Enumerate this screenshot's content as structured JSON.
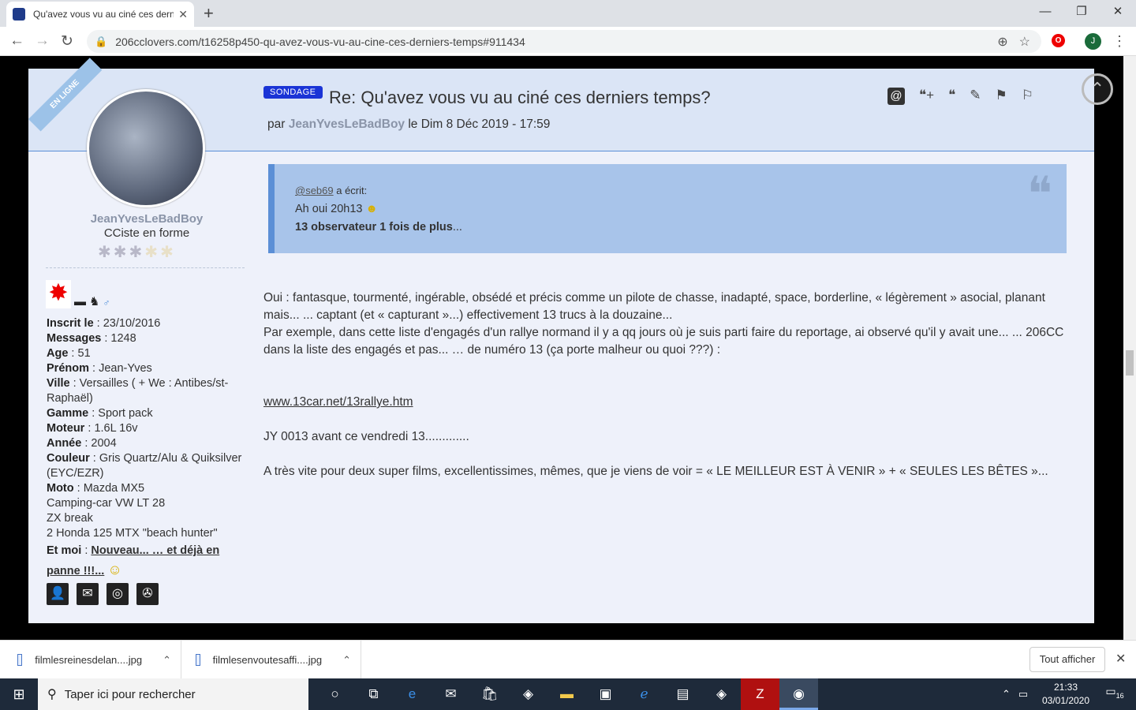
{
  "browser": {
    "tab_title": "Qu'avez vous vu au ciné ces derniers temps?",
    "url": "206cclovers.com/t16258p450-qu-avez-vous-vu-au-cine-ces-derniers-temps#911434",
    "profile_initial": "J"
  },
  "post": {
    "online_ribbon": "EN LIGNE",
    "badge": "SONDAGE",
    "title": "Re: Qu'avez vous vu au ciné ces derniers temps?",
    "by_prefix": "par",
    "author": "JeanYvesLeBadBoy",
    "date": "le Dim 8 Déc 2019 - 17:59",
    "quote": {
      "user": "@seb69",
      "wrote": " a écrit:",
      "line1": "Ah oui 20h13",
      "line2_bold": "13 observateur 1 fois de plus",
      "line2_rest": "..."
    },
    "body": {
      "p1": "Oui : fantasque, tourmenté, ingérable, obsédé et précis comme un pilote de chasse, inadapté, space, borderline, « légèrement » asocial, planant mais... ... captant  (et « capturant »...) effectivement 13 trucs à la douzaine...",
      "p2": "Par exemple, dans cette liste d'engagés d'un rallye  normand il y a qq jours où je suis parti faire du reportage, ai observé qu'il y avait une... ... 206CC dans la liste des engagés et pas... … de numéro 13 (ça porte malheur ou quoi ???) :",
      "link": "www.13car.net/13rallye.htm",
      "p3": "JY 0013 avant ce vendredi 13.............",
      "p4": "A très vite pour deux super films, excellentissimes, mêmes, que je viens de voir = «  LE MEILLEUR EST À VENIR » + « SEULES LES BÊTES »..."
    }
  },
  "user": {
    "name": "JeanYvesLeBadBoy",
    "rank": "CCiste en forme",
    "fields": [
      {
        "label": "Inscrit le",
        "value": "23/10/2016"
      },
      {
        "label": "Messages",
        "value": "1248"
      },
      {
        "label": "Age",
        "value": "51"
      },
      {
        "label": "Prénom",
        "value": "Jean-Yves"
      },
      {
        "label": "Ville",
        "value": "Versailles ( + We : Antibes/st-Raphaël)"
      },
      {
        "label": "Gamme",
        "value": "Sport pack"
      },
      {
        "label": "Moteur",
        "value": "1.6L 16v"
      },
      {
        "label": "Année",
        "value": "2004"
      },
      {
        "label": "Couleur",
        "value": "Gris Quartz/Alu & Quiksilver (EYC/EZR)"
      },
      {
        "label": "Moto",
        "value": "Mazda MX5"
      }
    ],
    "extra_lines": [
      "Camping-car VW LT 28",
      "ZX break",
      "2 Honda 125 MTX \"beach hunter\""
    ],
    "etmoi_label": "Et moi",
    "etmoi_link": "Nouveau... … et déjà en panne !!!..."
  },
  "downloads": {
    "item1": "filmlesreinesdelan....jpg",
    "item2": "filmlesenvoutesaffi....jpg",
    "show_all": "Tout afficher"
  },
  "taskbar": {
    "search_placeholder": "Taper ici pour rechercher",
    "time": "21:33",
    "date": "03/01/2020",
    "notif_count": "16"
  },
  "colors": {
    "accent": "#1a34d6",
    "header_bg": "#dbe5f6",
    "quote_bg": "#a8c4ea"
  }
}
